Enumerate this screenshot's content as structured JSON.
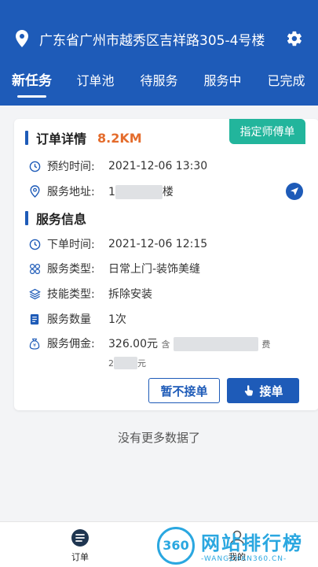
{
  "header": {
    "location": "广东省广州市越秀区吉祥路305-4号楼",
    "tabs": [
      {
        "label": "新任务",
        "active": true
      },
      {
        "label": "订单池",
        "active": false
      },
      {
        "label": "待服务",
        "active": false
      },
      {
        "label": "服务中",
        "active": false
      },
      {
        "label": "已完成",
        "active": false
      }
    ],
    "brand_color": "#1e5bb8"
  },
  "order": {
    "section_title": "订单详情",
    "distance": "8.2KM",
    "badge": "指定师傅单",
    "appointment_label": "预约时间:",
    "appointment_value": "2021-12-06 13:30",
    "address_label": "服务地址:",
    "address_prefix": "1",
    "address_suffix": "楼",
    "service_section_title": "服务信息",
    "order_time_label": "下单时间:",
    "order_time_value": "2021-12-06 12:15",
    "service_type_label": "服务类型:",
    "service_type_value": "日常上门-装饰美缝",
    "skill_type_label": "技能类型:",
    "skill_type_value": "拆除安装",
    "quantity_label": "服务数量",
    "quantity_value": "1次",
    "commission_label": "服务佣金:",
    "commission_value": "326.00元",
    "commission_note_prefix": "含",
    "commission_note_suffix": "费",
    "commission_line2_prefix": "2",
    "commission_line2_suffix": "元",
    "reject_button": "暂不接单",
    "accept_button": "接单"
  },
  "no_more_text": "没有更多数据了",
  "bottom_nav": {
    "orders_label": "订单",
    "mine_label": "我的"
  },
  "watermark": {
    "circle": "360",
    "main": "网站排行榜",
    "sub": "-WANGZHAN360.CN-"
  }
}
